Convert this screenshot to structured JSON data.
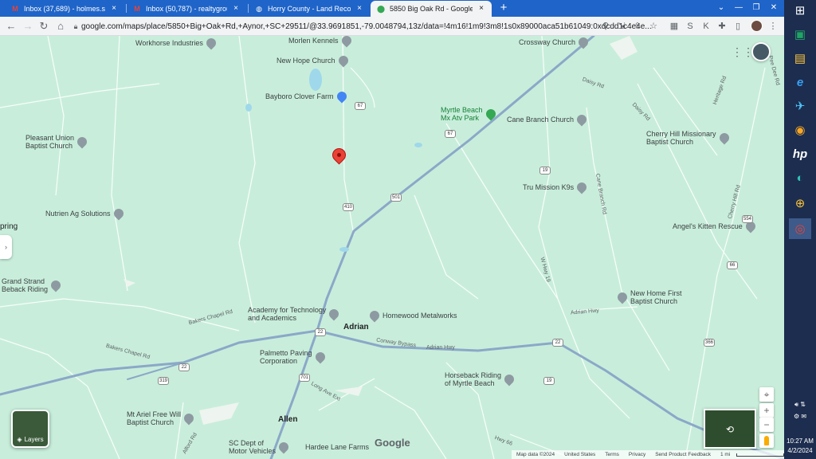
{
  "browser": {
    "tabs": [
      {
        "title": "Inbox (37,689) - holmes.stephen",
        "icon": "gmail-icon",
        "active": false
      },
      {
        "title": "Inbox (50,787) - realtygroupsc@",
        "icon": "gmail-icon",
        "active": false
      },
      {
        "title": "Horry County - Land Records",
        "icon": "globe-icon",
        "active": false
      },
      {
        "title": "5850 Big Oak Rd - Google Maps",
        "icon": "maps-icon",
        "active": true
      }
    ],
    "url": "google.com/maps/place/5850+Big+Oak+Rd,+Aynor,+SC+29511/@33.9691851,-79.0048794,13z/data=!4m16!1m9!3m8!1s0x89000aca51b61049:0xdcdd1c4e4e..."
  },
  "map": {
    "places": [
      {
        "name": "Morlen Kennels",
        "kind": "gray"
      },
      {
        "name": "Workhorse Industries",
        "kind": "gray"
      },
      {
        "name": "New Hope Church",
        "kind": "gray"
      },
      {
        "name": "Crossway Church",
        "kind": "gray"
      },
      {
        "name": "Bayboro Clover Farm",
        "kind": "blue"
      },
      {
        "name": "Myrtle Beach\nMx Atv Park",
        "kind": "green"
      },
      {
        "name": "Cane Branch Church",
        "kind": "gray"
      },
      {
        "name": "Pleasant Union\nBaptist Church",
        "kind": "gray"
      },
      {
        "name": "Cherry Hill Missionary\nBaptist Church",
        "kind": "gray"
      },
      {
        "name": "Tru Mission K9s",
        "kind": "gray"
      },
      {
        "name": "Nutrien Ag Solutions",
        "kind": "gray"
      },
      {
        "name": "Angel's Kitten Rescue",
        "kind": "gray"
      },
      {
        "name": "Grand Strand\nBeback Riding",
        "kind": "gray"
      },
      {
        "name": "New Home First\nBaptist Church",
        "kind": "gray"
      },
      {
        "name": "Academy for Technology\nand Academics",
        "kind": "gray"
      },
      {
        "name": "Homewood Metalworks",
        "kind": "gray"
      },
      {
        "name": "Palmetto Paving\nCorporation",
        "kind": "gray"
      },
      {
        "name": "Horseback Riding\nof Myrtle Beach",
        "kind": "gray"
      },
      {
        "name": "Mt Ariel Free Will\nBaptist Church",
        "kind": "gray"
      },
      {
        "name": "SC Dept of\nMotor Vehicles",
        "kind": "gray"
      },
      {
        "name": "Hardee Lane Farms",
        "kind": "gray"
      }
    ],
    "towns": [
      "Adrian",
      "Allen",
      "pring"
    ],
    "roads": [
      "Daisy Rd",
      "Daisy Rd",
      "Heritage Rd",
      "Pee Dee Rd",
      "Cherry Hill Rd",
      "Cane Branch Rd",
      "W Hwy 19",
      "Adrian Hwy",
      "Bakers Chapel Rd",
      "Bakers Chapel Rd",
      "Conway Bypass",
      "Adrian Hwy",
      "Long Ave Ext",
      "Alford Rd",
      "Hwy 66"
    ],
    "shields": [
      "67",
      "67",
      "501",
      "410",
      "19",
      "554",
      "66",
      "22",
      "22",
      "19",
      "319",
      "366",
      "701",
      "22"
    ],
    "layers_label": "Layers",
    "google_logo": "Google",
    "footer": [
      "Map data ©2024",
      "United States",
      "Terms",
      "Privacy",
      "Send Product Feedback",
      "1 mi"
    ]
  },
  "taskbar": {
    "time": "10:27 AM",
    "date": "4/2/2024",
    "apps": [
      "windows-icon",
      "excel-icon",
      "file-explorer-icon",
      "ie-icon",
      "remote-icon",
      "media-icon",
      "hp-icon",
      "edge-icon",
      "network-icon",
      "chrome-icon"
    ]
  }
}
